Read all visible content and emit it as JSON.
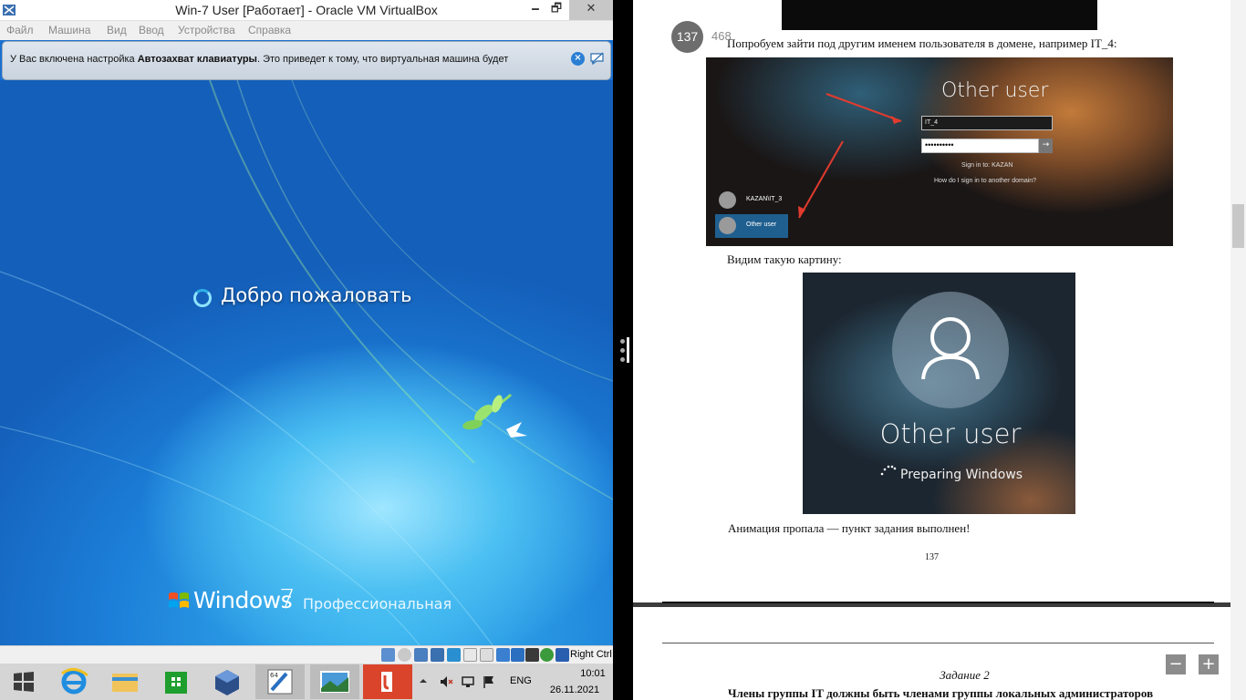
{
  "vbox": {
    "title": "Win-7 User [Работает] - Oracle VM VirtualBox",
    "window_controls": {
      "minimize": "🗕",
      "maximize": "🗗",
      "close": "✕"
    },
    "menu": [
      "Файл",
      "Машина",
      "Вид",
      "Ввод",
      "Устройства",
      "Справка"
    ],
    "notification": {
      "text_prefix": "У Вас включена настройка ",
      "text_bold": "Автозахват клавиатуры",
      "text_suffix": ". Это приведет к тому, что виртуальная машина будет"
    },
    "guest": {
      "welcome": "Добро пожаловать",
      "logo_windows": "Windows",
      "logo_version": "7",
      "logo_edition": "Профессиональная"
    },
    "status": {
      "host_key": "Right Ctrl"
    }
  },
  "taskbar": {
    "lang": "ENG",
    "time": "10:01",
    "date": "26.11.2021",
    "apps": [
      "start-icon",
      "ie-icon",
      "explorer-icon",
      "store-icon",
      "virtualbox-icon",
      "app64-icon",
      "photo-icon",
      "reader-icon"
    ]
  },
  "doc": {
    "page_current": "137",
    "page_total": "468",
    "para1": "Попробуем зайти под другим именем пользователя в домене, например IT_4:",
    "shot1": {
      "title": "Other user",
      "username": "IT_4",
      "password_mask": "••••••••••",
      "sign_in_to": "Sign in to: KAZAN",
      "how_link": "How do I sign in to another domain?",
      "account1": "KAZAN\\IT_3",
      "account2": "Other user"
    },
    "para2": "Видим такую картину:",
    "shot2": {
      "title": "Other user",
      "status": "Preparing Windows"
    },
    "para3": "Анимация пропала — пункт задания выполнен!",
    "page_number": "137",
    "page2": {
      "heading": "Задание 2",
      "text": "Члены группы IT должны быть членами группы локальных администраторов"
    },
    "zoom_out": "−",
    "zoom_in": "+"
  }
}
